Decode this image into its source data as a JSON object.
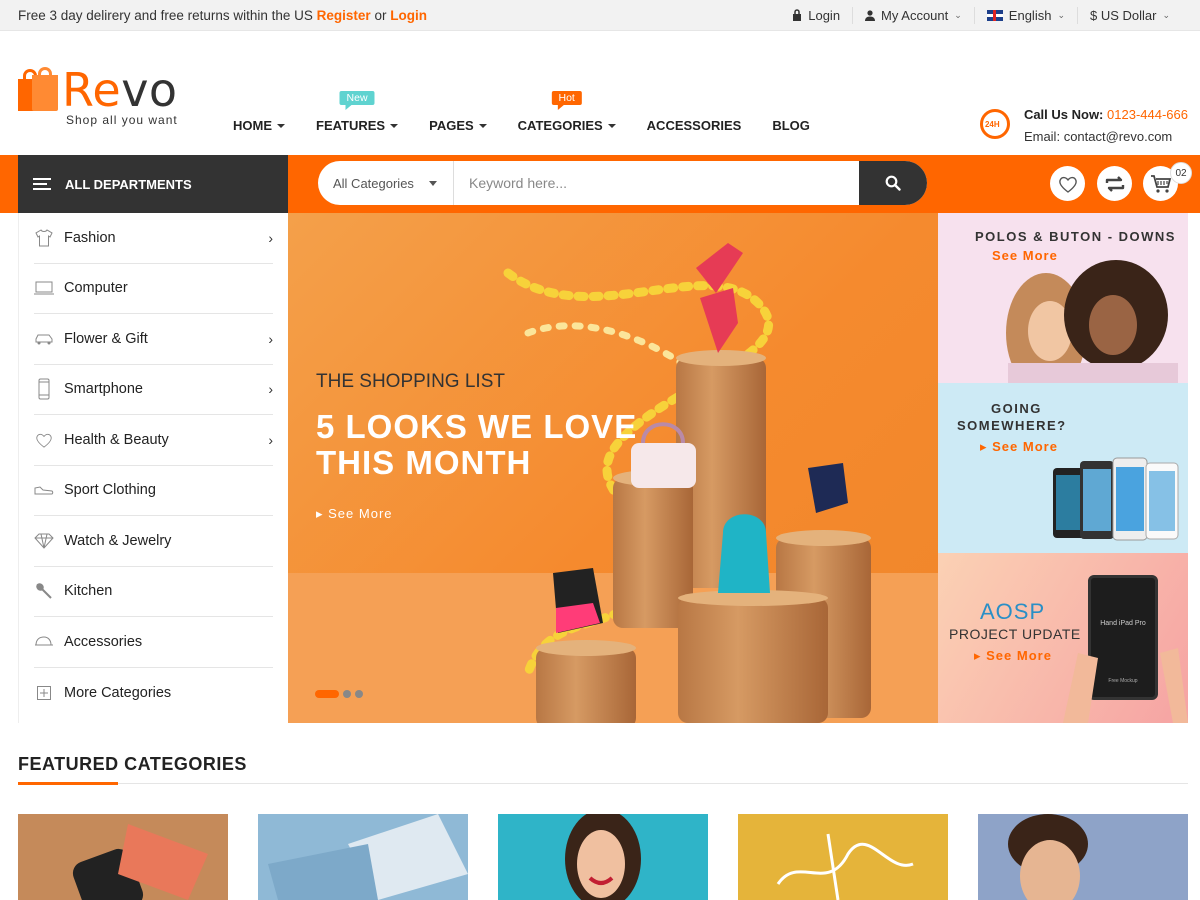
{
  "topbar": {
    "promo_text": "Free 3 day delirery and free returns within the US",
    "register": "Register",
    "or": "or",
    "login_link": "Login",
    "login": "Login",
    "account": "My Account",
    "language": "English",
    "currency": "$ US Dollar"
  },
  "logo": {
    "name_part1": "Re",
    "name_part2": "vo",
    "tagline": "Shop all you want"
  },
  "nav": {
    "items": [
      {
        "label": "HOME"
      },
      {
        "label": "FEATURES",
        "badge": "New"
      },
      {
        "label": "PAGES"
      },
      {
        "label": "CATEGORIES",
        "badge": "Hot"
      },
      {
        "label": "ACCESSORIES"
      },
      {
        "label": "BLOG"
      }
    ]
  },
  "contact": {
    "icon_text": "24H",
    "call_label": "Call Us Now:",
    "phone": "0123-444-666",
    "email_label": "Email:",
    "email": "contact@revo.com"
  },
  "departments": {
    "label": "ALL DEPARTMENTS"
  },
  "search": {
    "category": "All Categories",
    "placeholder": "Keyword here..."
  },
  "cart": {
    "count": "02"
  },
  "sidebar": {
    "items": [
      {
        "label": "Fashion",
        "icon": "shirt-icon",
        "has_sub": true
      },
      {
        "label": "Computer",
        "icon": "laptop-icon",
        "has_sub": false
      },
      {
        "label": "Flower & Gift",
        "icon": "car-icon",
        "has_sub": true
      },
      {
        "label": "Smartphone",
        "icon": "phone-icon",
        "has_sub": true
      },
      {
        "label": "Health & Beauty",
        "icon": "heart-icon",
        "has_sub": true
      },
      {
        "label": "Sport Clothing",
        "icon": "shoe-icon",
        "has_sub": false
      },
      {
        "label": "Watch & Jewelry",
        "icon": "diamond-icon",
        "has_sub": false
      },
      {
        "label": "Kitchen",
        "icon": "spoon-icon",
        "has_sub": false
      },
      {
        "label": "Accessories",
        "icon": "cap-icon",
        "has_sub": false
      }
    ],
    "more": "More Categories"
  },
  "hero": {
    "kicker": "THE SHOPPING LIST",
    "headline_1": "5 LOOKS WE LOVE",
    "headline_2": "THIS MONTH",
    "cta": "See More"
  },
  "banners": [
    {
      "title": "POLOS & BUTON - DOWNS",
      "cta": "See More"
    },
    {
      "title_1": "GOING",
      "title_2": "SOMEWHERE?",
      "cta": "See More"
    },
    {
      "title_1": "AOSP",
      "title_2": "PROJECT UPDATE",
      "cta": "See More",
      "device_text": "Hand iPad Pro",
      "device_subtext": "Free Mockup"
    }
  ],
  "featured": {
    "title": "FEATURED CATEGORIES",
    "tiles": [
      {
        "color": "#c58a5a"
      },
      {
        "color": "#8fb9d6"
      },
      {
        "color": "#2fb4c8"
      },
      {
        "color": "#e5b43a"
      },
      {
        "color": "#8ea3c8"
      }
    ]
  },
  "colors": {
    "accent": "#ff6600",
    "dark": "#333333"
  }
}
